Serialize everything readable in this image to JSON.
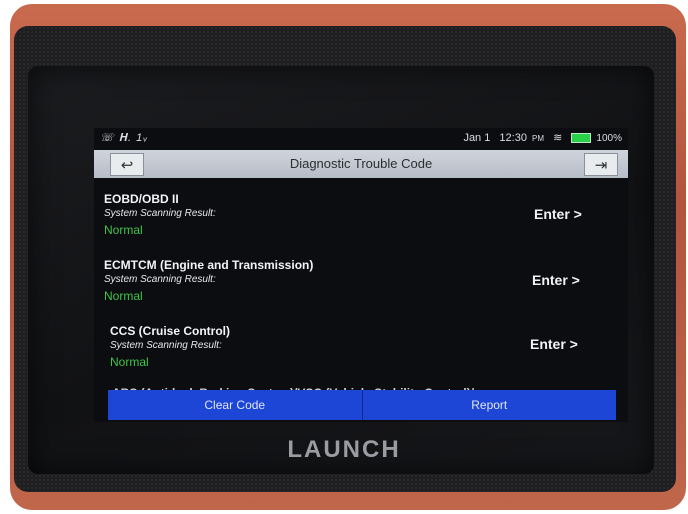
{
  "status_bar": {
    "left": "☏ 𝐇. 1ᵥ",
    "date": "Jan 1",
    "time": "12:30",
    "ampm": "PM",
    "battery": "100%"
  },
  "titlebar": {
    "title": "Diagnostic Trouble Code",
    "back_icon": "back-arrow-icon",
    "exit_icon": "exit-icon"
  },
  "items": [
    {
      "name": "EOBD/OBD II",
      "subtitle": "System Scanning Result:",
      "result": "Normal",
      "action": "Enter >"
    },
    {
      "name": "ECMTCM (Engine and Transmission)",
      "subtitle": "System Scanning Result:",
      "result": "Normal",
      "action": "Enter >"
    },
    {
      "name": "CCS (Cruise Control)",
      "subtitle": "System Scanning Result:",
      "result": "Normal",
      "action": "Enter >"
    }
  ],
  "partial_item": "ABS (Anti-lock Braking System)/VSC (Vehicle Stability Control)/",
  "bottom_buttons": {
    "clear": "Clear Code",
    "report": "Report"
  },
  "brand": "LAUNCH",
  "colors": {
    "result_green": "#41c44a",
    "button_blue": "#1d45d6",
    "case_orange": "#c0664a"
  }
}
